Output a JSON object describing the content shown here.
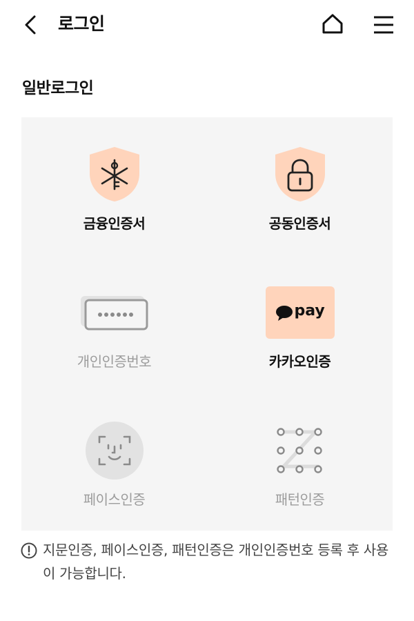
{
  "header": {
    "title": "로그인",
    "back_icon": "chevron-left-icon",
    "home_icon": "home-icon",
    "menu_icon": "hamburger-menu-icon"
  },
  "section": {
    "title": "일반로그인"
  },
  "methods": [
    {
      "label": "금융인증서",
      "icon": "financial-certificate-shield-icon",
      "enabled": true
    },
    {
      "label": "공동인증서",
      "icon": "lock-shield-icon",
      "enabled": true
    },
    {
      "label": "개인인증번호",
      "icon": "pin-card-icon",
      "enabled": false
    },
    {
      "label": "카카오인증",
      "icon": "kakao-pay-icon",
      "enabled": true,
      "badge_text": "pay"
    },
    {
      "label": "페이스인증",
      "icon": "face-scan-icon",
      "enabled": false
    },
    {
      "label": "패턴인증",
      "icon": "pattern-dots-icon",
      "enabled": false
    }
  ],
  "notice": {
    "icon": "exclamation-circle-icon",
    "text": "지문인증, 페이스인증, 패턴인증은 개인인증번호 등록 후 사용이 가능합니다."
  },
  "colors": {
    "accent_peach": "#ffd4bb",
    "kakao_bg": "#ffd4bb",
    "panel_bg": "#f5f5f5",
    "disabled_text": "#9c9c9c"
  }
}
